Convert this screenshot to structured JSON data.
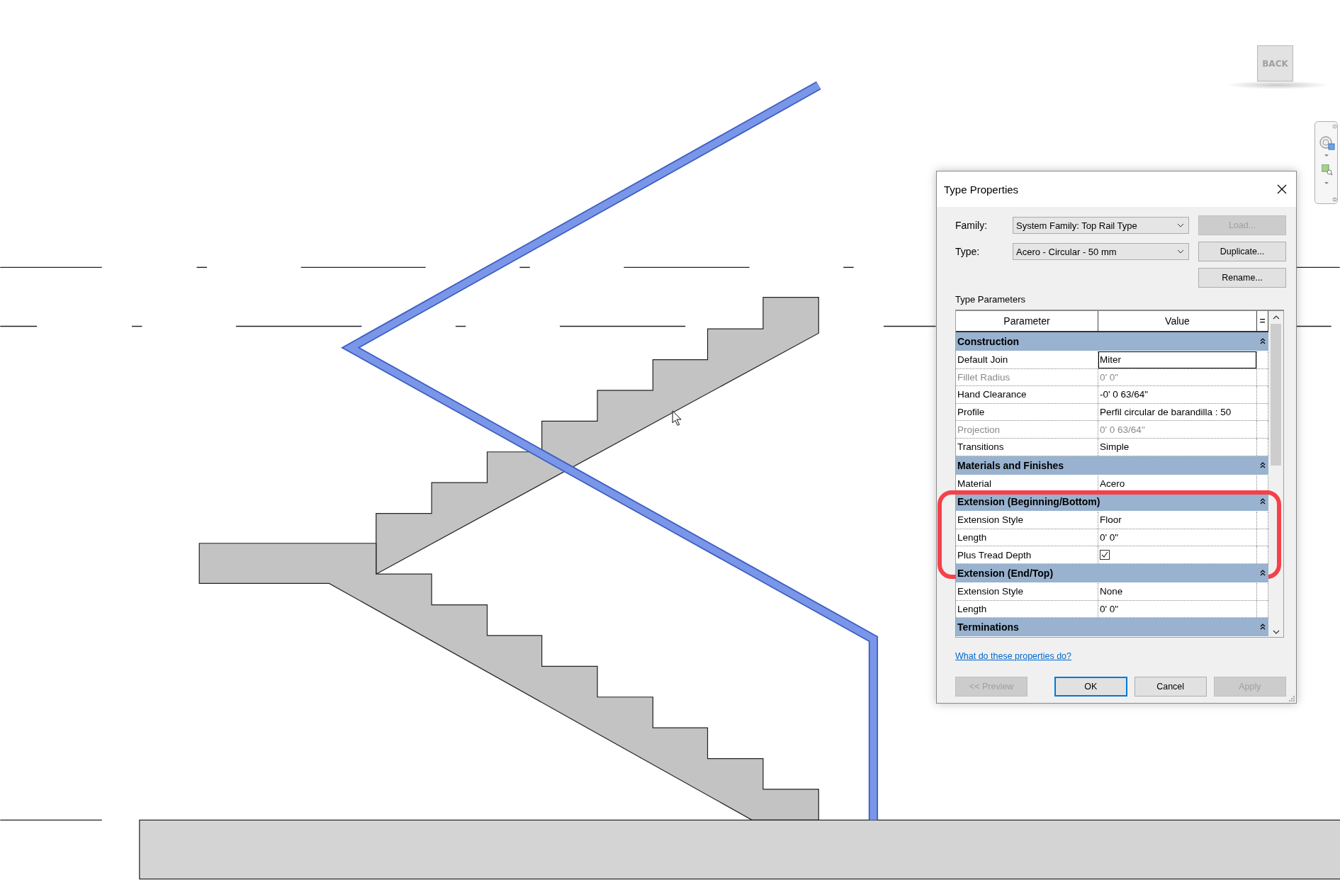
{
  "window": {
    "title": "Type Properties"
  },
  "family": {
    "label": "Family:",
    "value": "System Family: Top Rail Type"
  },
  "type": {
    "label": "Type:",
    "value": "Acero - Circular - 50 mm"
  },
  "side_buttons": [
    {
      "label": "Load...",
      "disabled": true
    },
    {
      "label": "Duplicate...",
      "disabled": false
    },
    {
      "label": "Rename...",
      "disabled": false
    }
  ],
  "section_label": "Type Parameters",
  "table": {
    "columns": [
      "Parameter",
      "Value",
      "="
    ],
    "groups": [
      {
        "name": "Construction",
        "expanded": true,
        "highlighted": false,
        "rows": [
          {
            "parameter": "Default Join",
            "value": "Miter",
            "kind": "text",
            "disabled": false,
            "selected": true
          },
          {
            "parameter": "Fillet Radius",
            "value": "0'  0\"",
            "kind": "text",
            "disabled": true,
            "selected": false
          },
          {
            "parameter": "Hand Clearance",
            "value": "-0'  0 63/64\"",
            "kind": "text",
            "disabled": false,
            "selected": false
          },
          {
            "parameter": "Profile",
            "value": "Perfil circular de barandilla : 50",
            "kind": "text",
            "disabled": false,
            "selected": false
          },
          {
            "parameter": "Projection",
            "value": "0'  0 63/64\"",
            "kind": "text",
            "disabled": true,
            "selected": false
          },
          {
            "parameter": "Transitions",
            "value": "Simple",
            "kind": "text",
            "disabled": false,
            "selected": false
          }
        ]
      },
      {
        "name": "Materials and Finishes",
        "expanded": true,
        "highlighted": false,
        "rows": [
          {
            "parameter": "Material",
            "value": "Acero",
            "kind": "text",
            "disabled": false,
            "selected": false
          }
        ]
      },
      {
        "name": "Extension (Beginning/Bottom)",
        "expanded": true,
        "highlighted": true,
        "rows": [
          {
            "parameter": "Extension Style",
            "value": "Floor",
            "kind": "text",
            "disabled": false,
            "selected": false
          },
          {
            "parameter": "Length",
            "value": "0'  0\"",
            "kind": "text",
            "disabled": false,
            "selected": false
          },
          {
            "parameter": "Plus Tread Depth",
            "kind": "checkbox",
            "checked": true,
            "disabled": false,
            "selected": false
          }
        ]
      },
      {
        "name": "Extension (End/Top)",
        "expanded": true,
        "highlighted": false,
        "rows": [
          {
            "parameter": "Extension Style",
            "value": "None",
            "kind": "text",
            "disabled": false,
            "selected": false
          },
          {
            "parameter": "Length",
            "value": "0'  0\"",
            "kind": "text",
            "disabled": false,
            "selected": false
          }
        ]
      },
      {
        "name": "Terminations",
        "expanded": true,
        "highlighted": false
      }
    ]
  },
  "help_link": "What do these properties do?",
  "buttons": [
    {
      "label": "<< Preview",
      "disabled": true,
      "default": false
    },
    {
      "label": "OK",
      "disabled": false,
      "default": true
    },
    {
      "label": "Cancel",
      "disabled": false,
      "default": false
    },
    {
      "label": "Apply",
      "disabled": true,
      "default": false
    }
  ],
  "view_cube": {
    "face": "BACK"
  }
}
